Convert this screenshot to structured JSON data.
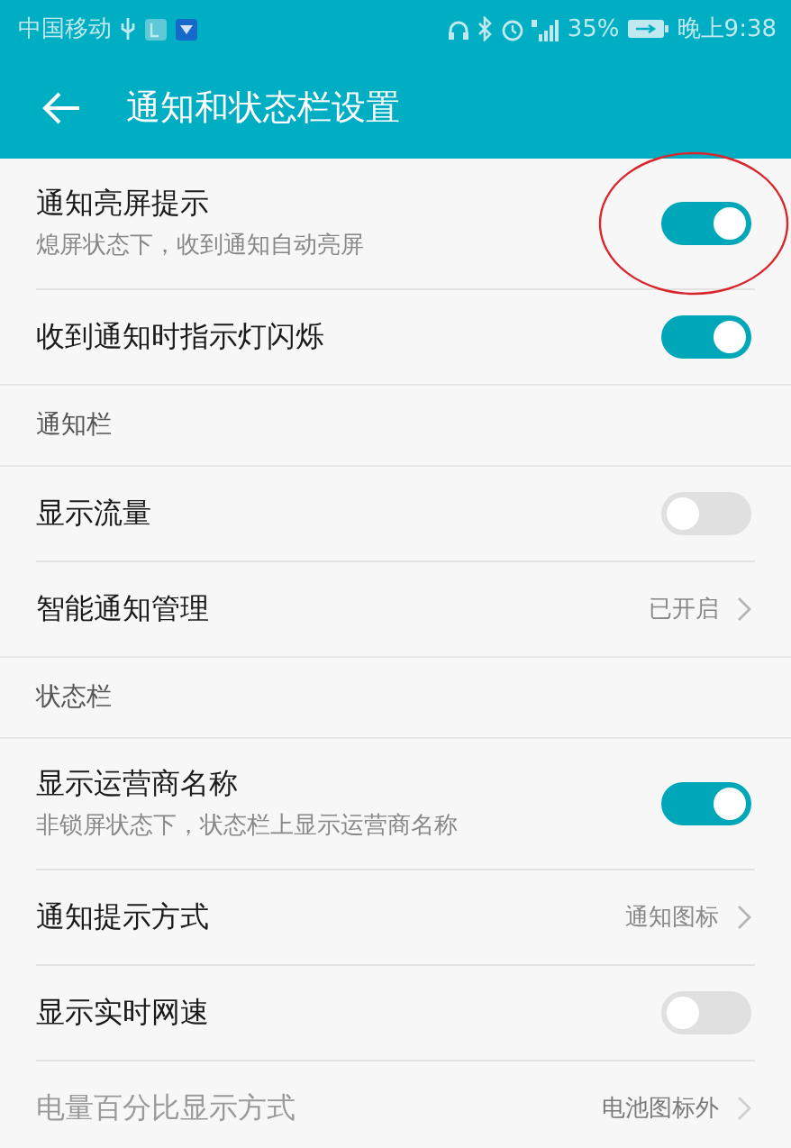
{
  "status_bar": {
    "carrier": "中国移动",
    "battery": "35%",
    "time": "晚上9:38"
  },
  "header": {
    "title": "通知和状态栏设置"
  },
  "sections": [
    {
      "items": [
        {
          "kind": "toggle",
          "title": "通知亮屏提示",
          "subtitle": "熄屏状态下，收到通知自动亮屏",
          "on": true,
          "circled": true,
          "disabled": false
        },
        {
          "kind": "toggle",
          "title": "收到通知时指示灯闪烁",
          "on": true,
          "circled": false,
          "disabled": false
        }
      ]
    },
    {
      "title": "通知栏",
      "items": [
        {
          "kind": "toggle",
          "title": "显示流量",
          "on": false,
          "circled": false,
          "disabled": false
        },
        {
          "kind": "link",
          "title": "智能通知管理",
          "value": "已开启",
          "circled": false,
          "disabled": false
        }
      ]
    },
    {
      "title": "状态栏",
      "items": [
        {
          "kind": "toggle",
          "title": "显示运营商名称",
          "subtitle": "非锁屏状态下，状态栏上显示运营商名称",
          "on": true,
          "circled": false,
          "disabled": false
        },
        {
          "kind": "link",
          "title": "通知提示方式",
          "value": "通知图标",
          "circled": false,
          "disabled": false
        },
        {
          "kind": "toggle",
          "title": "显示实时网速",
          "on": false,
          "circled": false,
          "disabled": false
        },
        {
          "kind": "link",
          "title": "电量百分比显示方式",
          "value": "电池图标外",
          "circled": false,
          "disabled": true
        }
      ]
    }
  ]
}
